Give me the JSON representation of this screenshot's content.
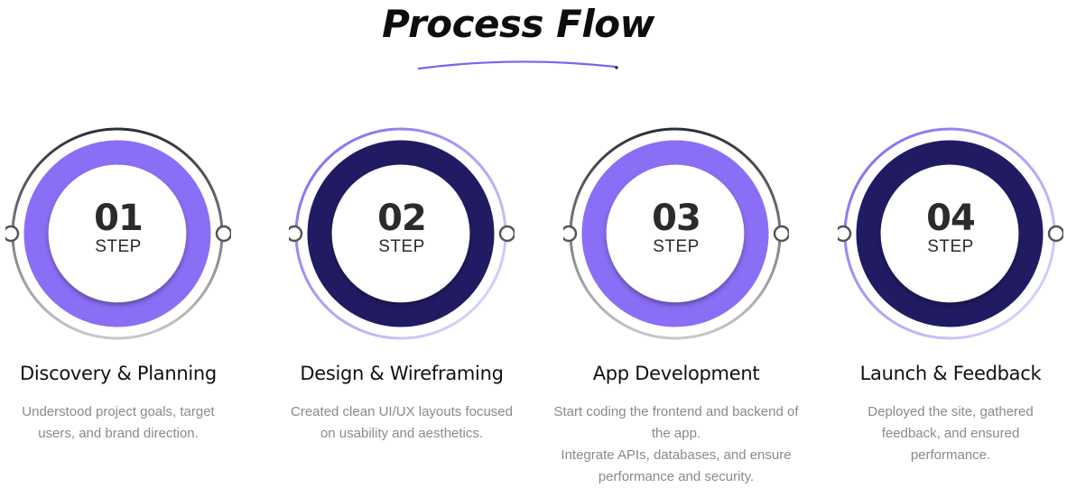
{
  "title": "Process Flow",
  "colors": {
    "light_purple": "#8a6ef5",
    "dark_navy": "#211b63",
    "outer_ring_dark": "#2d3037",
    "outer_ring_light": "#c8c8c8",
    "outer_ring_purple": "#7a62f0",
    "description_text": "#8a8a8a"
  },
  "steps": [
    {
      "number": "01",
      "label": "STEP",
      "heading": "Discovery & Planning",
      "description": [
        "Understood project goals, target",
        "users, and brand direction."
      ],
      "ring_color": "#8a6ef5",
      "outer_ring": [
        "#2d3037",
        "#c8c8c8"
      ]
    },
    {
      "number": "02",
      "label": "STEP",
      "heading": "Design & Wireframing",
      "description": [
        "Created clean UI/UX layouts focused",
        "on usability and aesthetics."
      ],
      "ring_color": "#211b63",
      "outer_ring": [
        "#7a62f0",
        "#e6e1fb"
      ]
    },
    {
      "number": "03",
      "label": "STEP",
      "heading": "App Development",
      "description": [
        "Start coding the frontend and backend of",
        "the app.",
        "Integrate APIs, databases, and ensure",
        "performance and security."
      ],
      "ring_color": "#8a6ef5",
      "outer_ring": [
        "#2d3037",
        "#c8c8c8"
      ]
    },
    {
      "number": "04",
      "label": "STEP",
      "heading": "Launch & Feedback",
      "description": [
        "Deployed the site, gathered",
        "feedback, and ensured",
        "performance."
      ],
      "ring_color": "#211b63",
      "outer_ring": [
        "#7a62f0",
        "#e6e1fb"
      ]
    }
  ]
}
